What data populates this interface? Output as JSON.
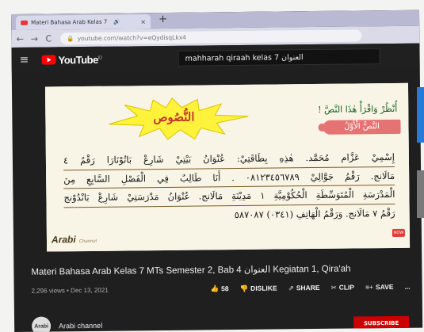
{
  "browser": {
    "tab_title": "Materi Bahasa Arab Kelas 7",
    "tab_sound": "🔊",
    "tab_close": "×",
    "new_tab": "+",
    "back": "←",
    "forward": "→",
    "reload": "C",
    "url": "youtube.com/watch?v=eQydisqLkx4"
  },
  "youtube": {
    "menu": "≡",
    "logo_text": "YouTube",
    "logo_sup": "ID",
    "search_query": "mahharah qiraah kelas 7 العنوان"
  },
  "slide": {
    "heading": "النُّصُوص",
    "instruction": "أُنْظُرْ وَاقْرَأْ هٰذَا النَّصَّ !",
    "text_label": "النَّصُّ الْأَوَّلُ",
    "paragraph_lines": [
      "إِسْمِيْ عَزَّام مُحَمَّد. هٰذِهِ بِطَاقَتِيْ: عُنْوَانُ بَيْتِيْ شَارِعْ بَاتُوْنَارَا رَقْمُ ٤",
      "مَالَانج. رَقْمُ جَوَّالِيْ ٠٨١٢٣٤٥٦٧٨٩ . أَنَا طَالِبٌ فِي الْفَصْلِ السَّابِعِ مِنَ",
      "الْمَدْرَسَةِ الْمُتَوَسِّطَةِ الْحُكُوْمِيَّةِ ١ مَدِيْنَةِ مَالَانج. عُنْوَانُ مَدْرَسَتِيْ شَارِعْ بَانْدُوْنج",
      "رَقْمُ ٧ مَالَانج. وَرَقْمُ الْهَاتِفِ (٠٣٤١) ٥٨٧٠٨٧"
    ],
    "brand": "Arabi",
    "brand_sub": "Channel",
    "badge": "NOW"
  },
  "video": {
    "title": "Materi Bahasa Arab Kelas 7 MTs Semester 2, Bab 4 العنوان Kegiatan 1, Qira'ah",
    "views_date": "2,296 views • Dec 13, 2021",
    "like_icon": "👍",
    "likes": "58",
    "dislike_icon": "👎",
    "dislike": "DISLIKE",
    "share_icon": "⇗",
    "share": "SHARE",
    "clip_icon": "✂",
    "clip": "CLIP",
    "save_icon": "≡+",
    "save": "SAVE",
    "more": "..."
  },
  "channel": {
    "avatar_text": "Arabi",
    "name": "Arabi channel",
    "subscribe": "SUBSCRIBE"
  },
  "colors": {
    "brand_red": "#ff0000",
    "slide_bg": "#f8f4e6",
    "starburst": "#fff23a",
    "heading_red": "#c0392b",
    "instruction_green": "#1b5e20"
  }
}
